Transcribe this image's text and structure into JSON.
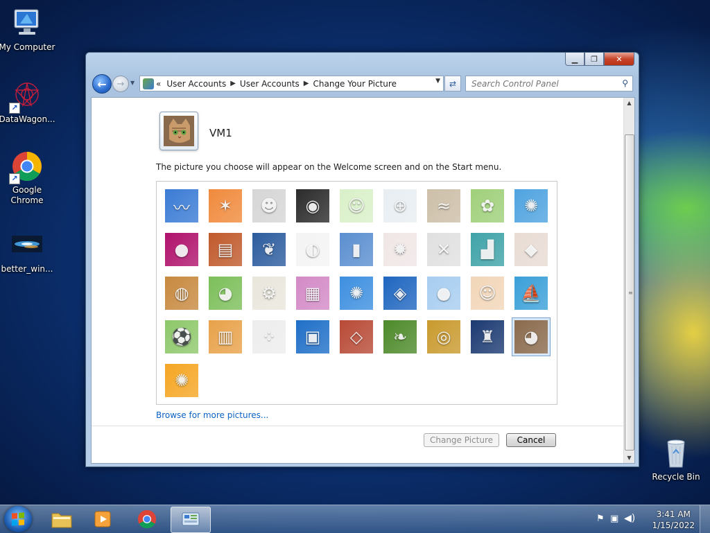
{
  "desktop": {
    "icons": [
      {
        "label": "My Computer"
      },
      {
        "label": "DataWagon..."
      },
      {
        "label": "Google Chrome"
      },
      {
        "label": "better_win..."
      },
      {
        "label": "Recycle Bin"
      }
    ]
  },
  "window": {
    "caption": {
      "minimize": "▁",
      "maximize": "❐",
      "close": "✕"
    },
    "breadcrumb": {
      "root_glyph": "«",
      "items": [
        "User Accounts",
        "User Accounts",
        "Change Your Picture"
      ]
    },
    "search": {
      "placeholder": "Search Control Panel"
    },
    "user": {
      "name": "VM1"
    },
    "description": "The picture you choose will appear on the Welcome screen and on the Start menu.",
    "pictures": [
      {
        "name": "roller-coaster",
        "bg": "#3a7bd5",
        "glyph": "〰"
      },
      {
        "name": "starfish",
        "bg": "#f08a3c",
        "glyph": "✶"
      },
      {
        "name": "robot-figure",
        "bg": "#d6d6d6",
        "glyph": "☻"
      },
      {
        "name": "turntable",
        "bg": "#2b2b2b",
        "glyph": "◉"
      },
      {
        "name": "lucky-cat",
        "bg": "#d9f0c8",
        "glyph": "☺"
      },
      {
        "name": "gyroscope",
        "bg": "#e8eef2",
        "glyph": "⊕"
      },
      {
        "name": "sleeping-kitten",
        "bg": "#cdbfa8",
        "glyph": "≈"
      },
      {
        "name": "pink-flower",
        "bg": "#9fd07a",
        "glyph": "✿"
      },
      {
        "name": "pinwheel",
        "bg": "#4fa3e0",
        "glyph": "✺"
      },
      {
        "name": "ball",
        "bg": "#b0126c",
        "glyph": "●"
      },
      {
        "name": "fabric",
        "bg": "#c05a2c",
        "glyph": "▤"
      },
      {
        "name": "leaf",
        "bg": "#2c5c9e",
        "glyph": "❦"
      },
      {
        "name": "border-collie",
        "bg": "#f4f4f4",
        "glyph": "◐"
      },
      {
        "name": "crayons",
        "bg": "#5b8fd0",
        "glyph": "▮"
      },
      {
        "name": "paper-star",
        "bg": "#f0e6e6",
        "glyph": "✹"
      },
      {
        "name": "jacks",
        "bg": "#e0e0e0",
        "glyph": "✕"
      },
      {
        "name": "stairs",
        "bg": "#3fa3a8",
        "glyph": "▟"
      },
      {
        "name": "origami-crane",
        "bg": "#e8dcd4",
        "glyph": "◆"
      },
      {
        "name": "guitar",
        "bg": "#c7893f",
        "glyph": "◍"
      },
      {
        "name": "pomeranian",
        "bg": "#7cbf5a",
        "glyph": "◕"
      },
      {
        "name": "toy-robot",
        "bg": "#e9e6dc",
        "glyph": "⚙"
      },
      {
        "name": "scarf",
        "bg": "#d38ac6",
        "glyph": "▦"
      },
      {
        "name": "sunflower",
        "bg": "#3d8fe0",
        "glyph": "✺"
      },
      {
        "name": "fish",
        "bg": "#1f66c0",
        "glyph": "◈"
      },
      {
        "name": "hot-air-balloon",
        "bg": "#a7cdf0",
        "glyph": "●"
      },
      {
        "name": "doll",
        "bg": "#f2d6b8",
        "glyph": "☺"
      },
      {
        "name": "sailboat",
        "bg": "#3aa0d8",
        "glyph": "⛵"
      },
      {
        "name": "soccer-ball",
        "bg": "#8ec86a",
        "glyph": "⚽"
      },
      {
        "name": "textile",
        "bg": "#e8a24a",
        "glyph": "▥"
      },
      {
        "name": "marbles",
        "bg": "#ededed",
        "glyph": "⁘"
      },
      {
        "name": "window-frame",
        "bg": "#1f6fc8",
        "glyph": "▣"
      },
      {
        "name": "pattern-rug",
        "bg": "#b84a36",
        "glyph": "◇"
      },
      {
        "name": "butterfly",
        "bg": "#4d8a2a",
        "glyph": "❧"
      },
      {
        "name": "spiral",
        "bg": "#c99a2e",
        "glyph": "◎"
      },
      {
        "name": "lighthouse",
        "bg": "#1c3a72",
        "glyph": "♜"
      },
      {
        "name": "tabby-cat",
        "bg": "#8a6a4c",
        "glyph": "◕",
        "selected": true
      },
      {
        "name": "gerbera",
        "bg": "#f5a623",
        "glyph": "✺"
      }
    ],
    "browse_link": "Browse for more pictures...",
    "buttons": {
      "change": "Change Picture",
      "cancel": "Cancel"
    }
  },
  "taskbar": {
    "clock": {
      "time": "3:41 AM",
      "date": "1/15/2022"
    }
  }
}
